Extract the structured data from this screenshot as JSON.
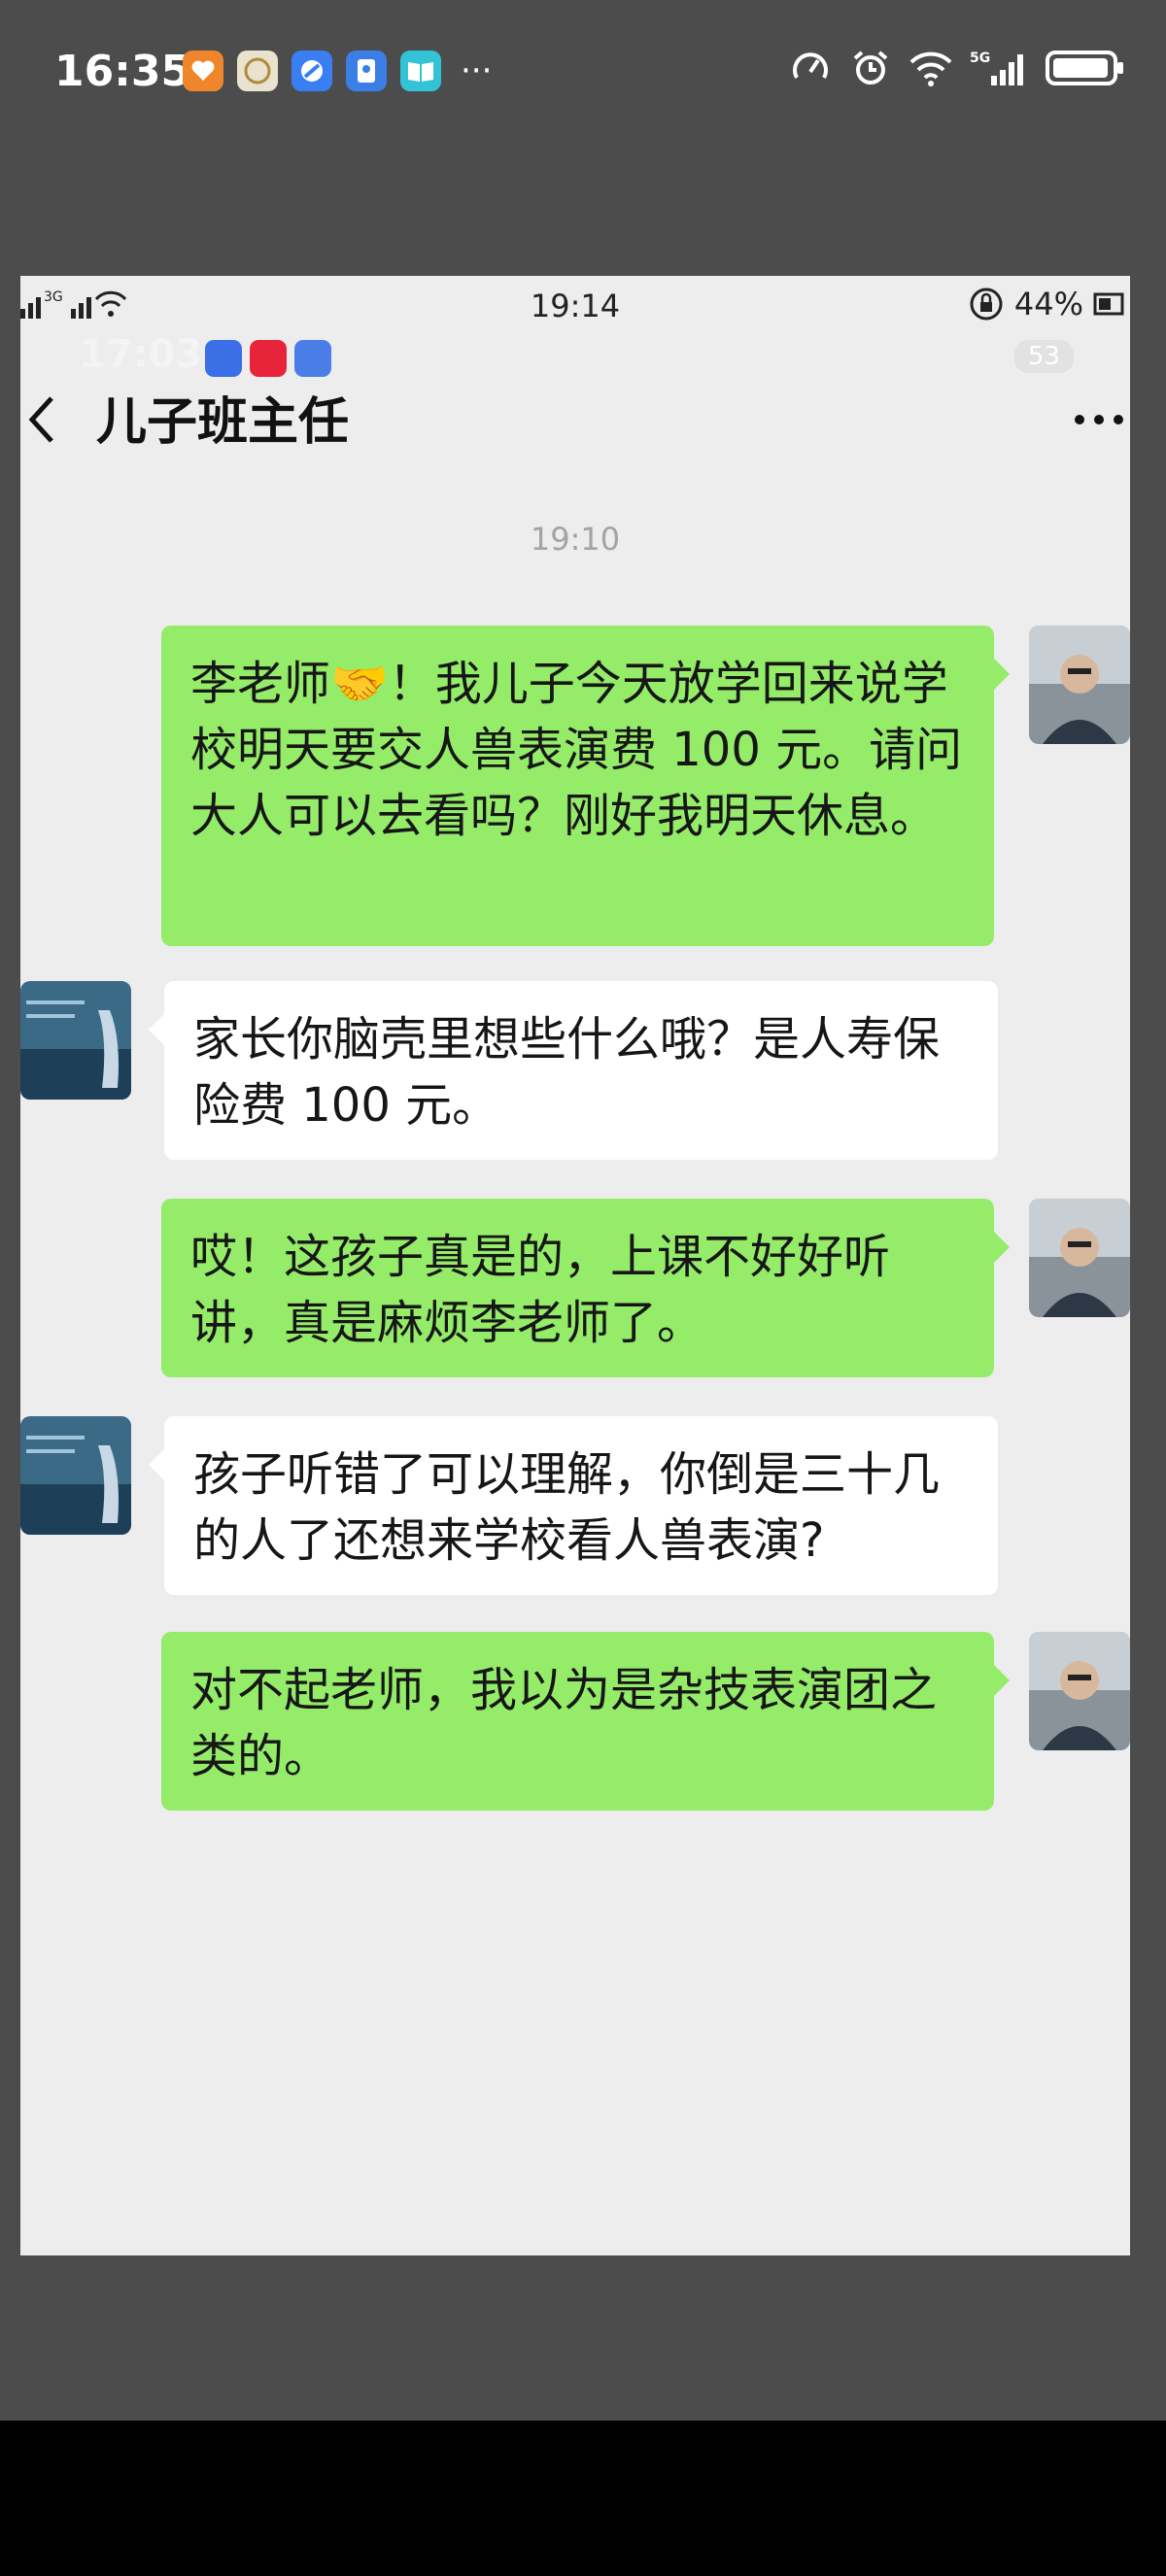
{
  "outer_status": {
    "time": "16:35",
    "more": "···",
    "apps": [
      {
        "icon": "heart-app-icon",
        "color": "#f0862c"
      },
      {
        "icon": "yoyo-app-icon",
        "color": "#e9e2cf"
      },
      {
        "icon": "browser-app-icon",
        "color": "#3a7ff2"
      },
      {
        "icon": "notebook-app-icon",
        "color": "#3b7ee6"
      },
      {
        "icon": "book-app-icon",
        "color": "#33c3d6"
      }
    ],
    "network": "5G"
  },
  "screenshot": {
    "status": {
      "signal": "3G",
      "time": "19:14",
      "battery": "44%"
    },
    "ghost_time": "17:03",
    "unread_count": "53",
    "chat_title": "儿子班主任",
    "timestamp": "19:10",
    "messages": [
      {
        "side": "right",
        "text": "李老师🤝！我儿子今天放学回来说学校明天要交人兽表演费 100 元。请问大人可以去看吗？刚好我明天休息。"
      },
      {
        "side": "left",
        "text": "家长你脑壳里想些什么哦？是人寿保险费 100 元。"
      },
      {
        "side": "right",
        "text": "哎！这孩子真是的，上课不好好听讲，真是麻烦李老师了。"
      },
      {
        "side": "left",
        "text": "孩子听错了可以理解，你倒是三十几的人了还想来学校看人兽表演?"
      },
      {
        "side": "right",
        "text": "对不起老师，我以为是杂技表演团之类的。"
      }
    ]
  },
  "colors": {
    "sent_bubble": "#95ec69",
    "received_bubble": "#ffffff",
    "chat_bg": "#ededed",
    "frame": "#4c4c4c"
  }
}
